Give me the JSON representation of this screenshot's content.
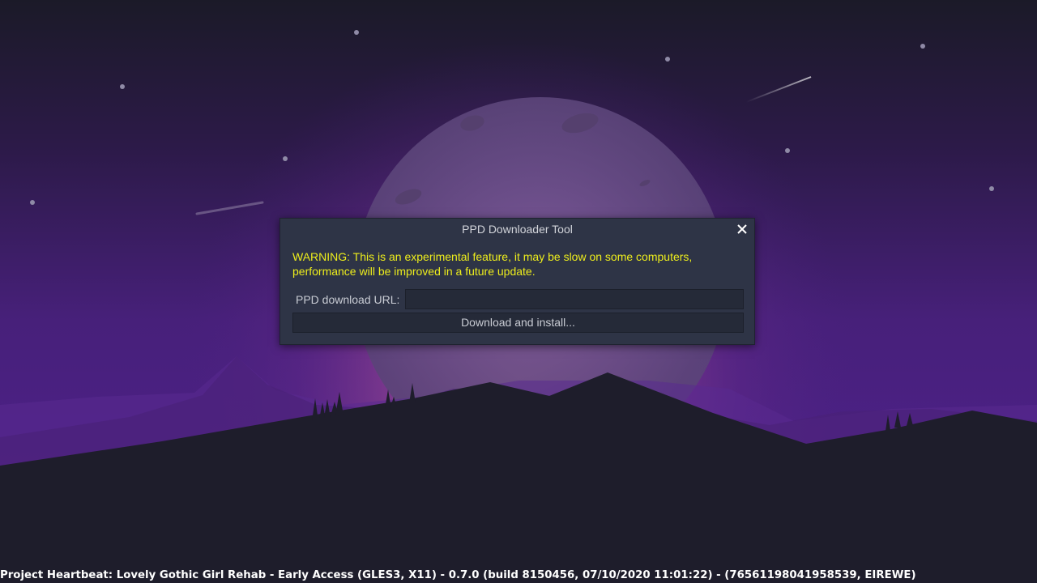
{
  "dialog": {
    "title": "PPD Downloader Tool",
    "close_icon": "close-icon",
    "warning": "WARNING: This is an experimental feature, it may be slow on some computers, performance will be improved in a future update.",
    "url_label": "PPD download URL:",
    "url_value": "",
    "download_button": "Download and install..."
  },
  "status_bar": {
    "text": "Project Heartbeat: Lovely Gothic Girl Rehab - Early Access (GLES3, X11) - 0.7.0 (build 8150456, 07/10/2020  11:01:22) - (76561198041958539, EIREWE)"
  },
  "colors": {
    "background_dark": "#1b1a26",
    "sky_purple": "#4a1f7a",
    "moon": "#5f4c86",
    "dialog_bg": "#2e3446",
    "warning_text": "#eded1c"
  }
}
